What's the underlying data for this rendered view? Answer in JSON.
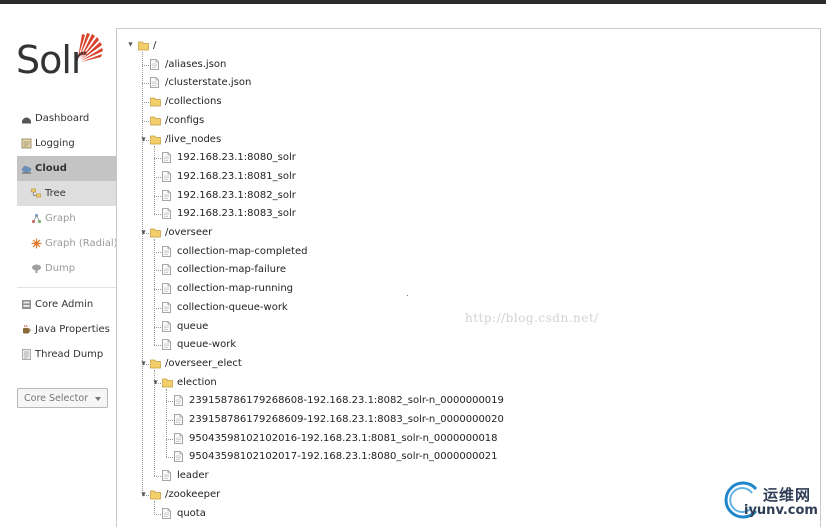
{
  "app": {
    "logo_text": "Solr"
  },
  "sidebar": {
    "items": [
      {
        "label": "Dashboard",
        "icon": "dashboard-icon"
      },
      {
        "label": "Logging",
        "icon": "logging-icon"
      },
      {
        "label": "Cloud",
        "icon": "cloud-icon",
        "active": true
      },
      {
        "label": "Tree",
        "icon": "tree-icon",
        "sub": true,
        "active": true
      },
      {
        "label": "Graph",
        "icon": "graph-icon",
        "sub": true
      },
      {
        "label": "Graph (Radial)",
        "icon": "graph-radial-icon",
        "sub": true
      },
      {
        "label": "Dump",
        "icon": "dump-icon",
        "sub": true
      },
      {
        "label": "Core Admin",
        "icon": "core-admin-icon"
      },
      {
        "label": "Java Properties",
        "icon": "java-icon"
      },
      {
        "label": "Thread Dump",
        "icon": "thread-dump-icon"
      }
    ],
    "core_selector": {
      "placeholder": "Core Selector"
    }
  },
  "tree": {
    "root": "/",
    "nodes": [
      {
        "label": "/aliases.json",
        "type": "file"
      },
      {
        "label": "/clusterstate.json",
        "type": "file"
      },
      {
        "label": "/collections",
        "type": "folder",
        "expanded": false
      },
      {
        "label": "/configs",
        "type": "folder",
        "expanded": false
      },
      {
        "label": "/live_nodes",
        "type": "folder",
        "expanded": true
      },
      {
        "label": "192.168.23.1:8080_solr",
        "type": "file"
      },
      {
        "label": "192.168.23.1:8081_solr",
        "type": "file"
      },
      {
        "label": "192.168.23.1:8082_solr",
        "type": "file"
      },
      {
        "label": "192.168.23.1:8083_solr",
        "type": "file"
      },
      {
        "label": "/overseer",
        "type": "folder",
        "expanded": true
      },
      {
        "label": "collection-map-completed",
        "type": "file"
      },
      {
        "label": "collection-map-failure",
        "type": "file"
      },
      {
        "label": "collection-map-running",
        "type": "file"
      },
      {
        "label": "collection-queue-work",
        "type": "file"
      },
      {
        "label": "queue",
        "type": "file"
      },
      {
        "label": "queue-work",
        "type": "file"
      },
      {
        "label": "/overseer_elect",
        "type": "folder",
        "expanded": true
      },
      {
        "label": "election",
        "type": "folder",
        "expanded": true
      },
      {
        "label": "239158786179268608-192.168.23.1:8082_solr-n_0000000019",
        "type": "file"
      },
      {
        "label": "239158786179268609-192.168.23.1:8083_solr-n_0000000020",
        "type": "file"
      },
      {
        "label": "95043598102102016-192.168.23.1:8081_solr-n_0000000018",
        "type": "file"
      },
      {
        "label": "95043598102102017-192.168.23.1:8080_solr-n_0000000021",
        "type": "file"
      },
      {
        "label": "leader",
        "type": "file"
      },
      {
        "label": "/zookeeper",
        "type": "folder",
        "expanded": true
      },
      {
        "label": "quota",
        "type": "file"
      }
    ]
  },
  "watermark": "http://blog.csdn.net/",
  "brand": {
    "cn": "运维网",
    "en": "iyunv.com"
  },
  "colors": {
    "folder": "#f3cf6b",
    "active_nav": "#c4c4c4",
    "sub_active_nav": "#dedede",
    "logo_accent": "#d9412b"
  }
}
